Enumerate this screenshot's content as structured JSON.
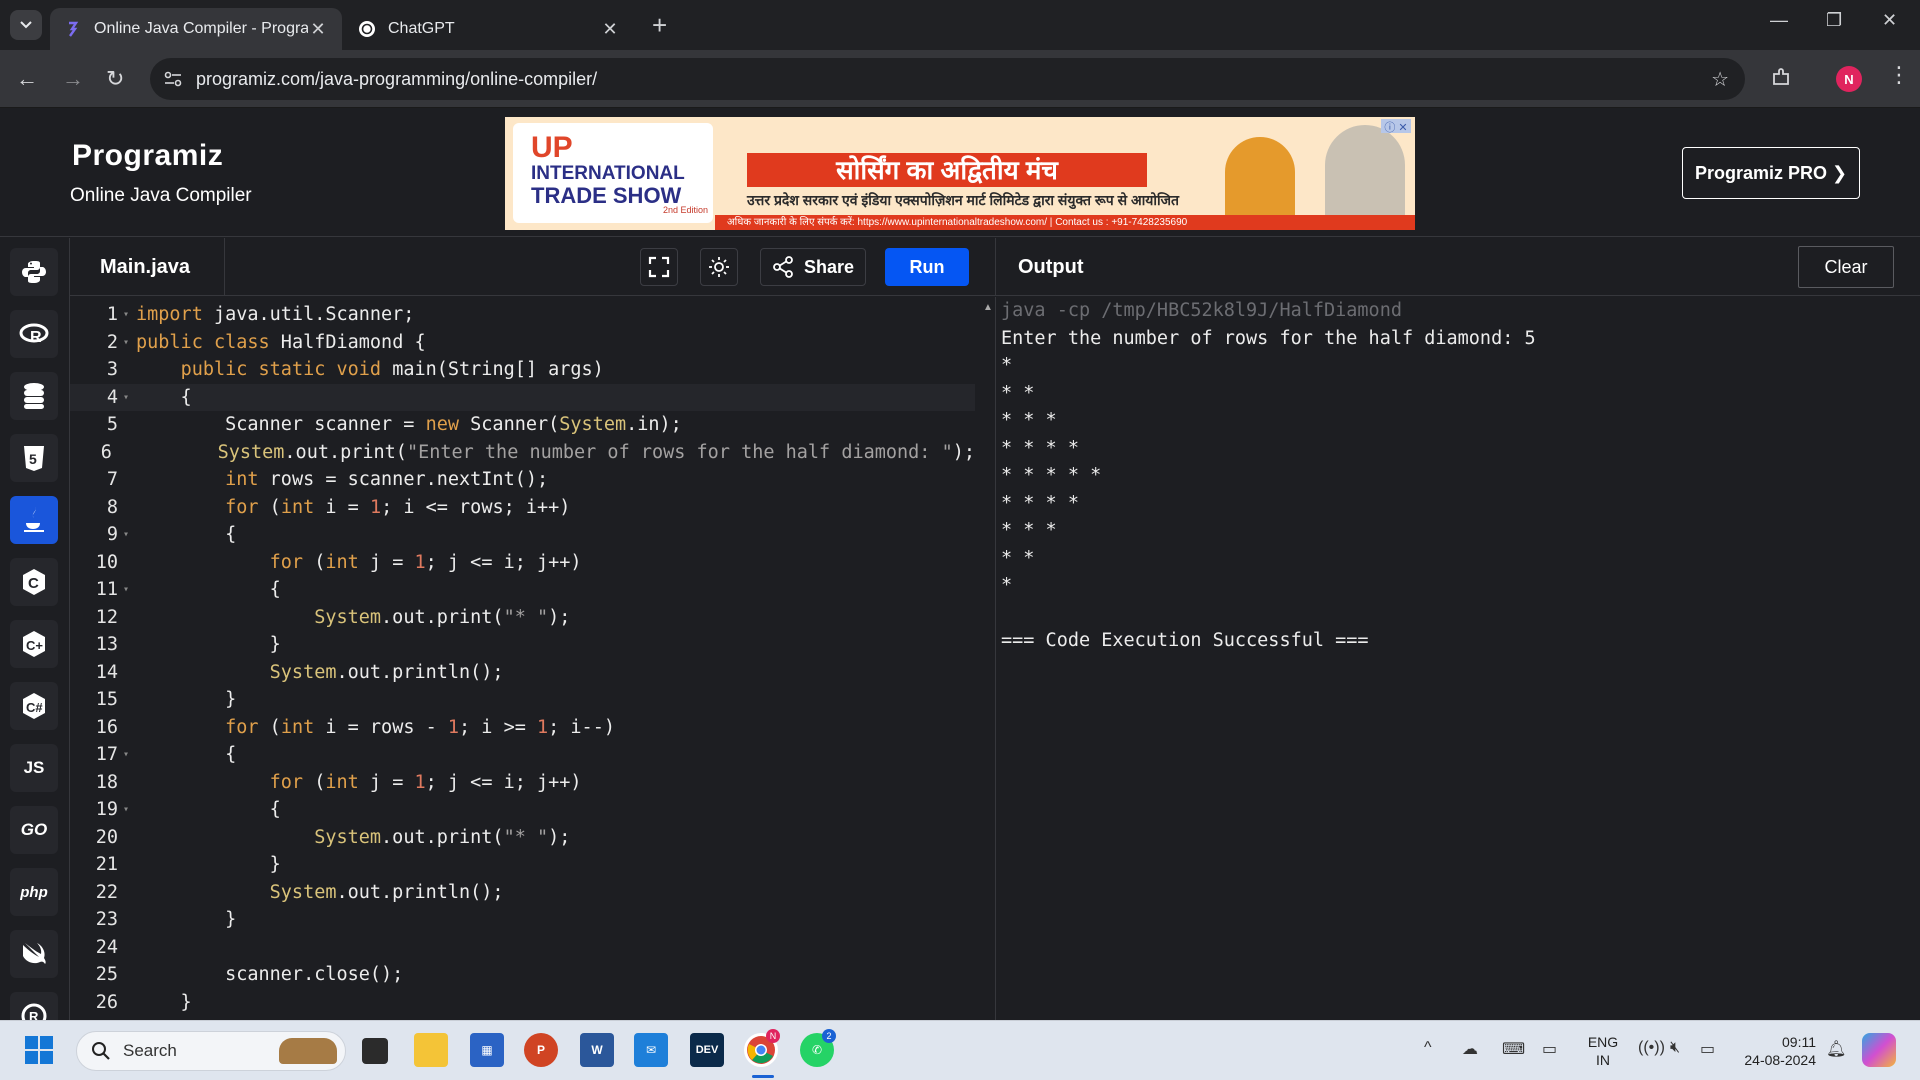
{
  "browser": {
    "tabs": [
      {
        "title": "Online Java Compiler - Program",
        "active": true
      },
      {
        "title": "ChatGPT",
        "active": false
      }
    ],
    "url": "programiz.com/java-programming/online-compiler/",
    "profile_initial": "N"
  },
  "site": {
    "logo": "Programiz",
    "subtitle": "Online Java Compiler",
    "pro_button": "Programiz PRO ❯",
    "banner": {
      "left_line1": "INTERNATIONAL",
      "left_line2": "TRADE SHOW",
      "edition": "2nd Edition",
      "title": "सोर्सिंग का अद्वितीय मंच",
      "subtitle": "उत्तर प्रदेश सरकार एवं इंडिया एक्सपोज़िशन मार्ट लिमिटेड द्वारा संयुक्त रूप से आयोजित",
      "footer": "अधिक जानकारी के लिए संपर्क करें: https://www.upinternationaltradeshow.com/ | Contact us : +91-7428235690"
    }
  },
  "languages": [
    "python",
    "r",
    "sql",
    "html",
    "java",
    "c",
    "cpp",
    "csharp",
    "JS",
    "GO",
    "php",
    "swift",
    "rust"
  ],
  "editor": {
    "file_name": "Main.java",
    "share_label": "Share",
    "run_label": "Run",
    "lines": [
      "import java.util.Scanner;",
      "public class HalfDiamond {",
      "    public static void main(String[] args)",
      "    {",
      "        Scanner scanner = new Scanner(System.in);",
      "        System.out.print(\"Enter the number of rows for the half diamond: \");",
      "        int rows = scanner.nextInt();",
      "        for (int i = 1; i <= rows; i++)",
      "        {",
      "            for (int j = 1; j <= i; j++)",
      "            {",
      "                System.out.print(\"* \");",
      "            }",
      "            System.out.println();",
      "        }",
      "        for (int i = rows - 1; i >= 1; i--)",
      "        {",
      "            for (int j = 1; j <= i; j++)",
      "            {",
      "                System.out.print(\"* \");",
      "            }",
      "            System.out.println();",
      "        }",
      "",
      "        scanner.close();",
      "    }"
    ]
  },
  "output": {
    "title": "Output",
    "clear_label": "Clear",
    "command": "java -cp /tmp/HBC52k8l9J/HalfDiamond",
    "lines": [
      "Enter the number of rows for the half diamond: 5",
      "*",
      "* *",
      "* * *",
      "* * * *",
      "* * * * *",
      "* * * *",
      "* * *",
      "* *",
      "*",
      "",
      "=== Code Execution Successful ==="
    ]
  },
  "taskbar": {
    "search_placeholder": "Search",
    "lang_line1": "ENG",
    "lang_line2": "IN",
    "time": "09:11",
    "date": "24-08-2024",
    "chrome_badge": "N",
    "whatsapp_badge": "2"
  }
}
